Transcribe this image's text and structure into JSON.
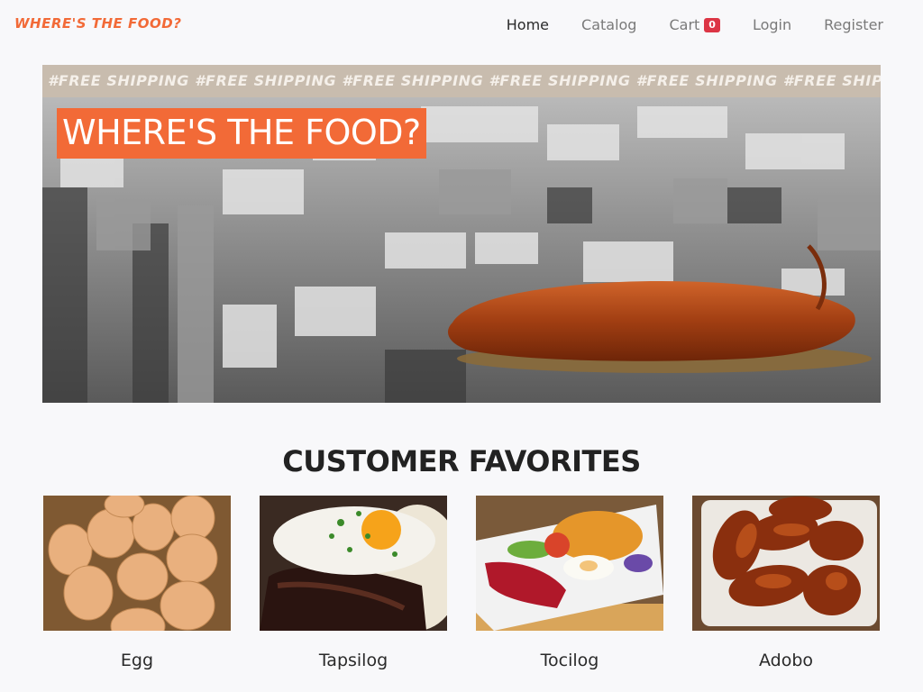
{
  "navbar": {
    "brand": "WHERE'S THE FOOD?",
    "links": [
      {
        "label": "Home",
        "active": true
      },
      {
        "label": "Catalog",
        "active": false
      },
      {
        "label": "Cart",
        "active": false
      },
      {
        "label": "Login",
        "active": false
      },
      {
        "label": "Register",
        "active": false
      }
    ],
    "cart_count": "0"
  },
  "hero": {
    "ticker": "#FREE SHIPPING #FREE SHIPPING #FREE SHIPPING #FREE SHIPPING #FREE SHIPPING #FREE SHIPPING #FREE SHIPPING #FREE SHIP",
    "title": "WHERE'S THE FOOD?"
  },
  "favorites": {
    "title": "CUSTOMER FAVORITES",
    "items": [
      {
        "name": "Egg"
      },
      {
        "name": "Tapsilog"
      },
      {
        "name": "Tocilog"
      },
      {
        "name": "Adobo"
      }
    ]
  },
  "colors": {
    "brand": "#f26a37",
    "badge": "#dc3545",
    "ticker_bg": "#c8bcae"
  }
}
